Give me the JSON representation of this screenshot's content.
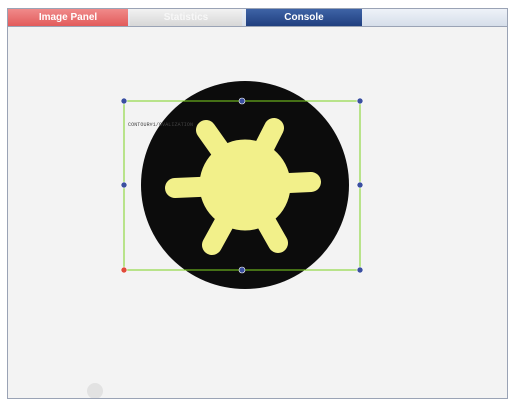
{
  "tabs": [
    {
      "label": "Image Panel",
      "state": "inactive",
      "color": "#e25b5b"
    },
    {
      "label": "Statistics",
      "state": "inactive",
      "color": "#d7d7d7"
    },
    {
      "label": "Console",
      "state": "active",
      "color": "#203f7f"
    }
  ],
  "roi": {
    "label": "CONTOUR#1/OVALIZATION",
    "color": "#7ed321",
    "handle_color": "#3a4fa0"
  },
  "specimen": {
    "disk_color": "#0c0c0c",
    "shape_color": "#f2f08a"
  }
}
